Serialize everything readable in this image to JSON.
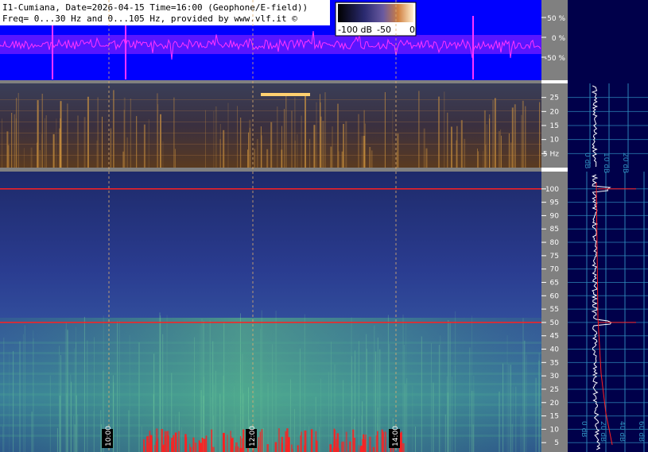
{
  "header": {
    "line1": "I1-Cumiana, Date=2026-04-15 Time=16:00 (Geophone/E-field))",
    "line2": "Freq= 0...30 Hz and 0...105 Hz, provided by www.vlf.it ©"
  },
  "colorbar": {
    "labels": [
      "-100 dB",
      "-50",
      "0"
    ]
  },
  "chart_data": [
    {
      "type": "line",
      "name": "waveform-amplitude",
      "y_ticks": [
        "50 %",
        "0 %",
        "-50 %"
      ],
      "y_values": [
        50,
        0,
        -50
      ],
      "colors": {
        "background": "#0000ff",
        "trace": "#ff33ff"
      }
    },
    {
      "type": "heatmap",
      "name": "spectrogram-0-30hz",
      "ylim": [
        0,
        30
      ],
      "y_tick_values": [
        5,
        10,
        15,
        20,
        25
      ],
      "y_tick_labels": [
        "5 Hz",
        "10",
        "15",
        "20",
        "25"
      ],
      "colors": {
        "low": "#1a1e3c",
        "high": "#f0b040"
      }
    },
    {
      "type": "heatmap",
      "name": "spectrogram-0-105hz",
      "ylim": [
        0,
        105
      ],
      "y_tick_values": [
        5,
        10,
        15,
        20,
        25,
        30,
        35,
        40,
        45,
        50,
        55,
        60,
        65,
        70,
        75,
        80,
        85,
        90,
        95,
        100
      ],
      "y_tick_labels": [
        "5",
        "10",
        "15",
        "20",
        "25",
        "30",
        "35",
        "40",
        "45",
        "50",
        "55",
        "60",
        "65",
        "70",
        "75",
        "80",
        "85",
        "90",
        "95",
        "100"
      ],
      "x_time_labels": [
        "10:00",
        "12:00",
        "14:00"
      ],
      "horizontal_lines_hz": [
        50,
        100
      ],
      "colors": {
        "low": "#2a3a8c",
        "high": "#60d080",
        "line": "#ff2020"
      }
    },
    {
      "type": "line",
      "name": "average-spectrum",
      "x_labels": [
        "0 dB",
        "10 dB",
        "20 dB"
      ],
      "x_labels_lower": [
        "0 dB",
        "20 dB",
        "40 dB",
        "60 dB"
      ],
      "colors": {
        "background": "#00004a",
        "grid": "#3090c0",
        "trace": "#ffffff",
        "fit": "#ff2020"
      }
    }
  ]
}
